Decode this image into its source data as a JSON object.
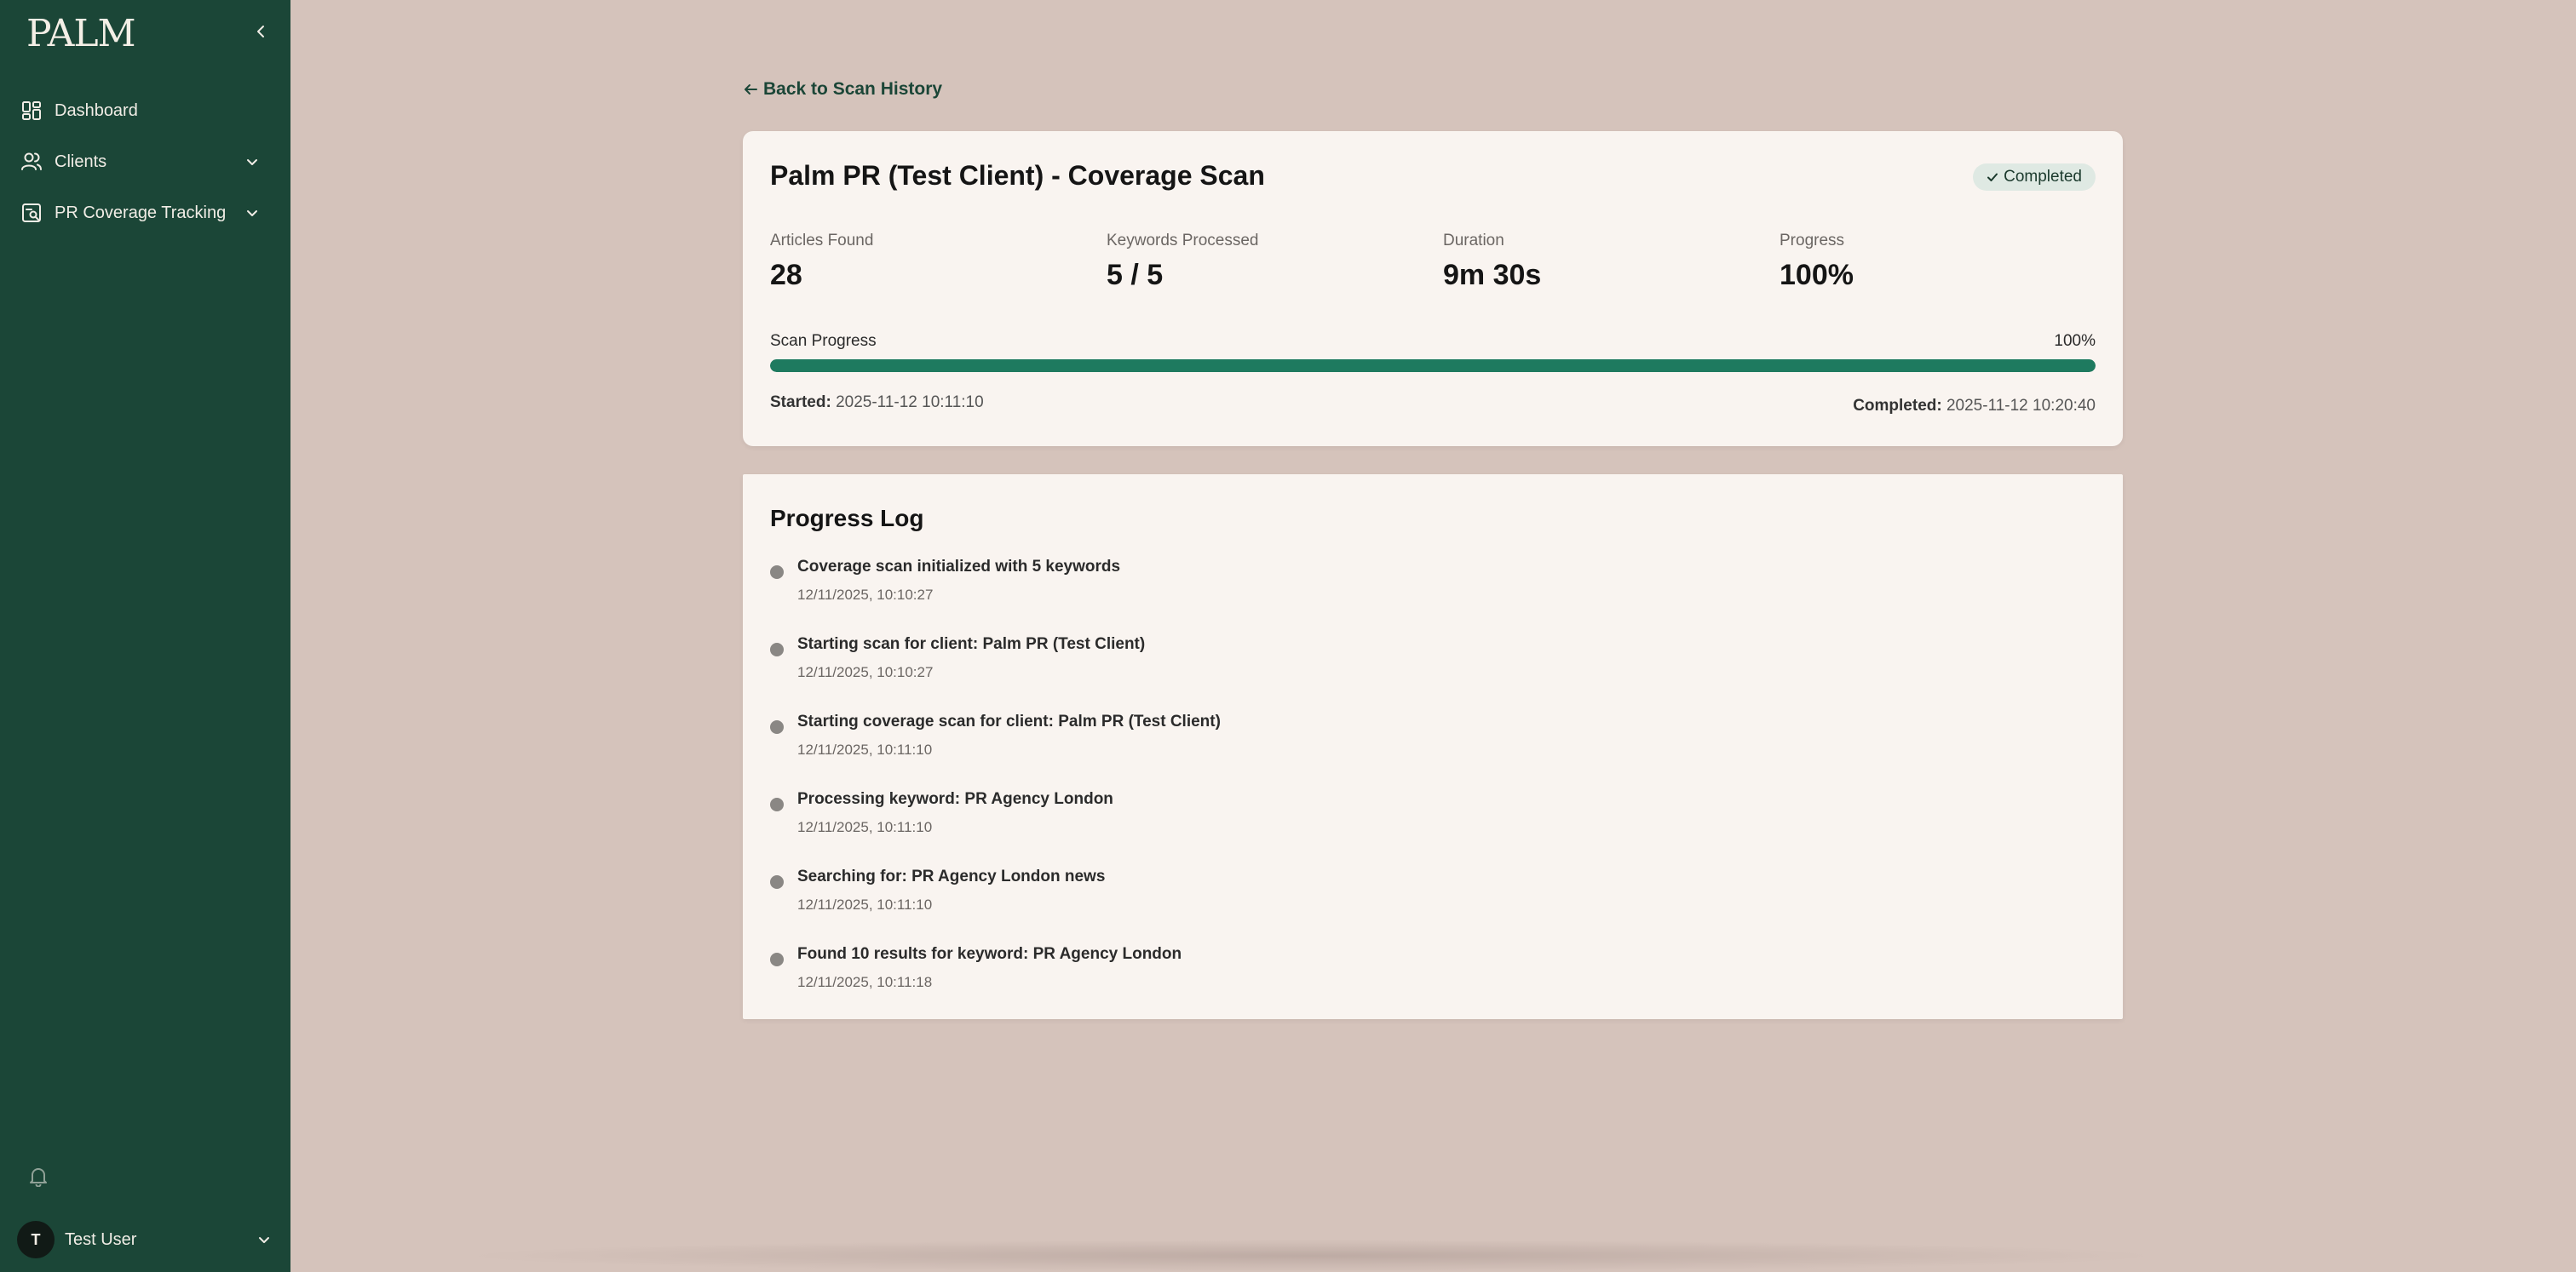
{
  "sidebar": {
    "logo": "PALM",
    "items": [
      {
        "label": "Dashboard",
        "icon": "grid-icon"
      },
      {
        "label": "Clients",
        "icon": "users-icon"
      },
      {
        "label": "PR Coverage Tracking",
        "icon": "coverage-icon"
      }
    ],
    "user": {
      "initial": "T",
      "name": "Test User"
    }
  },
  "main": {
    "back_label": "Back to Scan History",
    "scan": {
      "title": "Palm PR (Test Client) - Coverage Scan",
      "status": "Completed",
      "stats": [
        {
          "label": "Articles Found",
          "value": "28"
        },
        {
          "label": "Keywords Processed",
          "value": "5 / 5"
        },
        {
          "label": "Duration",
          "value": "9m 30s"
        },
        {
          "label": "Progress",
          "value": "100%"
        }
      ],
      "progress_label": "Scan Progress",
      "progress_percent": "100%",
      "progress_fraction": 1.0,
      "started_label": "Started:",
      "started_value": "2025-11-12 10:11:10",
      "completed_label": "Completed:",
      "completed_value": "2025-11-12 10:20:40"
    },
    "log": {
      "title": "Progress Log",
      "entries": [
        {
          "message": "Coverage scan initialized with 5 keywords",
          "time": "12/11/2025, 10:10:27"
        },
        {
          "message": "Starting scan for client: Palm PR (Test Client)",
          "time": "12/11/2025, 10:10:27"
        },
        {
          "message": "Starting coverage scan for client: Palm PR (Test Client)",
          "time": "12/11/2025, 10:11:10"
        },
        {
          "message": "Processing keyword: PR Agency London",
          "time": "12/11/2025, 10:11:10"
        },
        {
          "message": "Searching for: PR Agency London news",
          "time": "12/11/2025, 10:11:10"
        },
        {
          "message": "Found 10 results for keyword: PR Agency London",
          "time": "12/11/2025, 10:11:18"
        }
      ]
    }
  },
  "colors": {
    "sidebar_bg": "#1b4637",
    "page_bg": "#d5c3bb",
    "card_bg": "#f9f4f0",
    "accent": "#1e7a5f",
    "badge_bg": "#dfe9e3"
  }
}
